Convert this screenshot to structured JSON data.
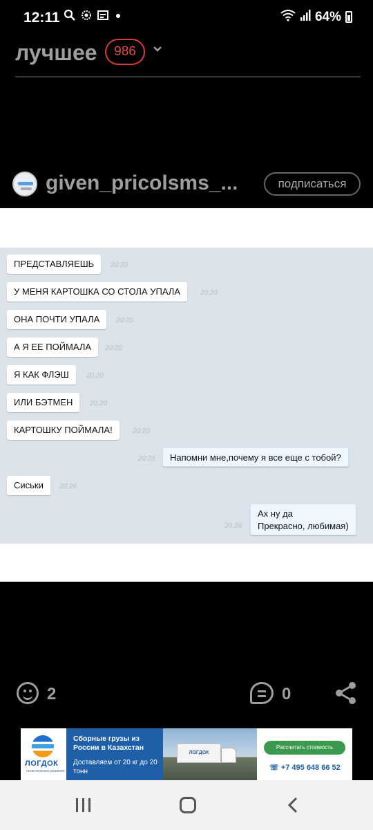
{
  "status_bar": {
    "time": "12:11",
    "battery": "64%",
    "icons": [
      "search-icon",
      "settings-icon",
      "gallery-icon",
      "dot-icon",
      "wifi-icon",
      "signal-icon",
      "battery-icon"
    ]
  },
  "header": {
    "title": "лучшее",
    "badge": "986"
  },
  "author": {
    "name": "given_pricolsms_...",
    "subscribe_label": "подписаться"
  },
  "chat": {
    "messages": [
      {
        "text": "ПРЕДСТАВЛЯЕШЬ",
        "time": "20:20",
        "dir": "in"
      },
      {
        "text": "У МЕНЯ КАРТОШКА СО СТОЛА УПАЛА",
        "time": "20:20",
        "dir": "in"
      },
      {
        "text": "ОНА ПОЧТИ УПАЛА",
        "time": "20:20",
        "dir": "in"
      },
      {
        "text": "А Я ЕЕ ПОЙМАЛА",
        "time": "20:20",
        "dir": "in"
      },
      {
        "text": "Я КАК ФЛЭШ",
        "time": "20:20",
        "dir": "in"
      },
      {
        "text": "ИЛИ БЭТМЕН",
        "time": "20:20",
        "dir": "in"
      },
      {
        "text": "КАРТОШКУ ПОЙМАЛА!",
        "time": "20:20",
        "dir": "in"
      },
      {
        "text": "Напомни мне,почему я все еще с тобой?",
        "time": "20:25",
        "dir": "out"
      },
      {
        "text": "Сиськи",
        "time": "20:26",
        "dir": "in"
      },
      {
        "text_line1": "Ах ну да",
        "text_line2": "Прекрасно, любимая)",
        "time": "20:26",
        "dir": "out"
      }
    ]
  },
  "actions": {
    "reactions_count": "2",
    "comments_count": "0"
  },
  "ad": {
    "logo_text": "ЛОГДОК",
    "logo_sub": "логистическое решение",
    "headline": "Сборные грузы из России в Казахстан",
    "subline": "Доставляем от 20 кг до 20 тонн",
    "truck_label": "ЛОГДОК",
    "cta": "Рассчитать стоимость",
    "phone": "+7 495 648 66 52"
  },
  "colors": {
    "background": "#000000",
    "badge": "#d83a3a",
    "muted_text": "#9e9e9e",
    "chat_bg": "#dde3ea",
    "ad_blue": "#1f5fa8",
    "ad_green": "#3c9a4e"
  }
}
